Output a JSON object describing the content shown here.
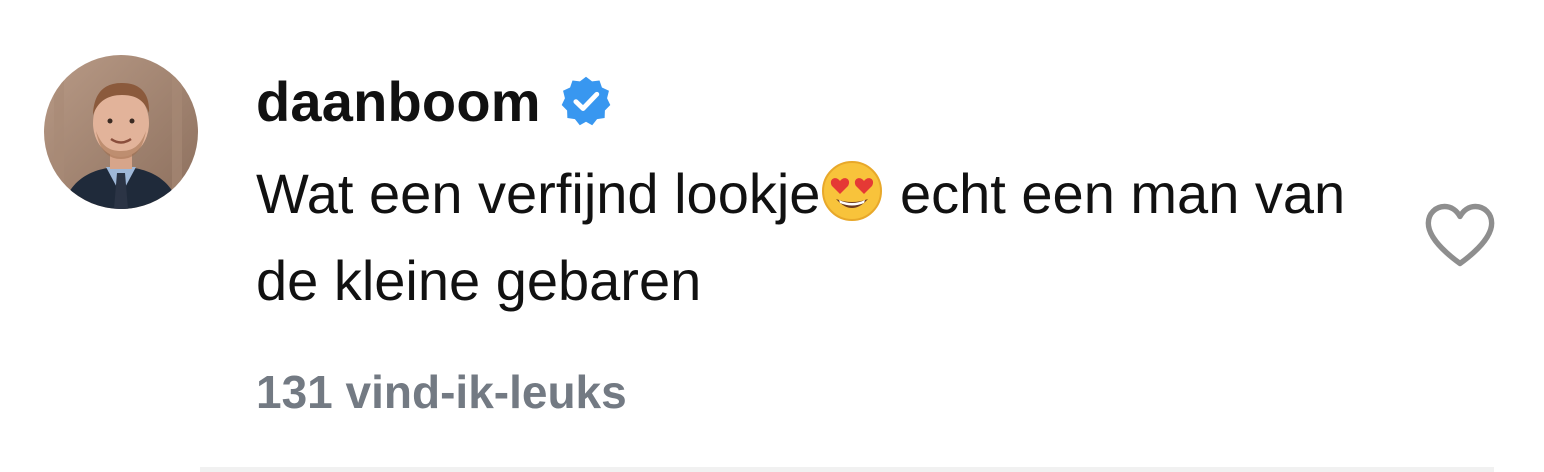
{
  "comment": {
    "username": "daanboom",
    "verified_icon": "verified-badge-icon",
    "text_before_emoji": "Wat een verfijnd lookje",
    "emoji": "heart-eyes-emoji",
    "text_after_emoji": " echt een man van de kleine gebaren",
    "likes_label": "131 vind-ik-leuks",
    "like_icon": "heart-outline-icon"
  },
  "colors": {
    "verified_blue": "#3897f0",
    "likes_gray": "#737a83",
    "text": "#111111",
    "heart_outline": "#8e8e8e"
  }
}
